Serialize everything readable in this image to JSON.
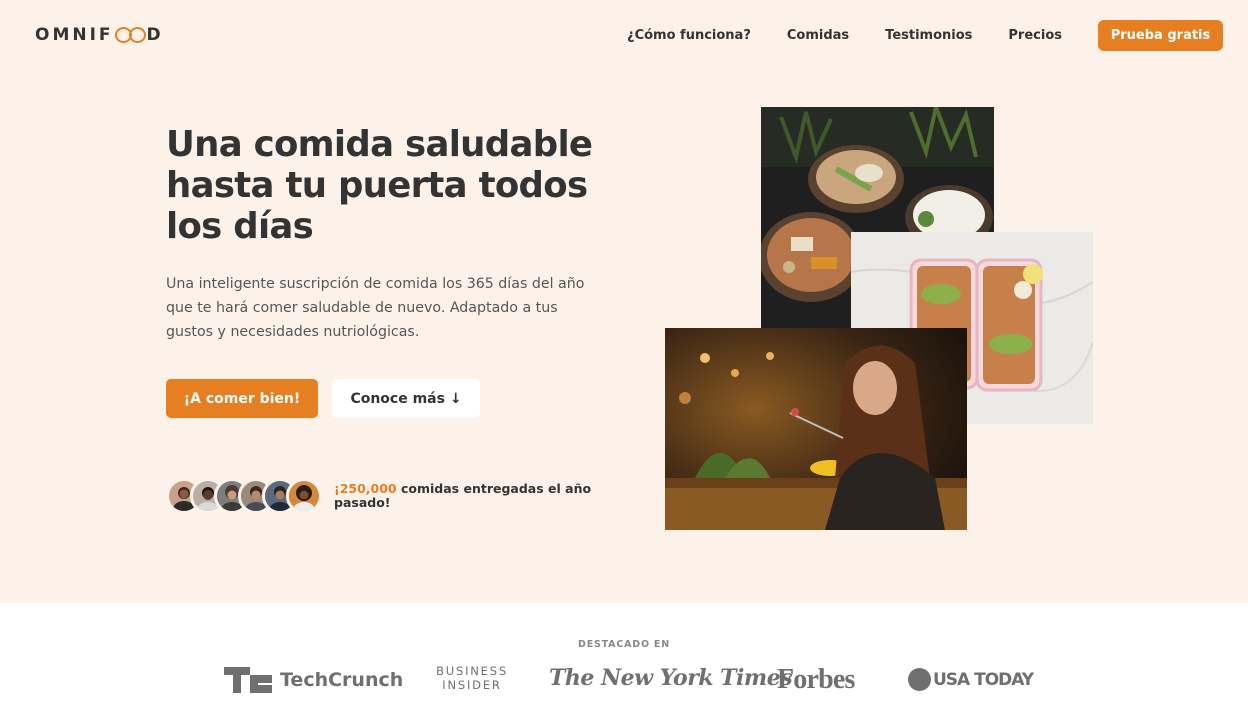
{
  "brand": {
    "logo_prefix": "OMNIF",
    "logo_suffix": "D",
    "accent_color": "#e67e22",
    "background_color": "#fdf2e9"
  },
  "nav": {
    "items": [
      {
        "label": "¿Cómo funciona?"
      },
      {
        "label": "Comidas"
      },
      {
        "label": "Testimonios"
      },
      {
        "label": "Precios"
      }
    ],
    "cta_label": "Prueba gratis"
  },
  "hero": {
    "title": "Una comida saludable hasta tu puerta todos los días",
    "description": "Una inteligente suscripción de comida los 365 días del año que te hará comer saludable de nuevo. Adaptado a tus gustos y necesidades nutriológicas.",
    "primary_button": "¡A comer bien!",
    "secondary_button": "Conoce más ↓",
    "delivered_highlight": "¡250,000",
    "delivered_text": " comidas entregadas el año pasado!",
    "customer_avatar_count": 6
  },
  "featured": {
    "heading": "DESTACADO EN",
    "logos": {
      "techcrunch": "TechCrunch",
      "business_insider_line1": "BUSINESS",
      "business_insider_line2": "INSIDER",
      "nyt": "The New York Times",
      "forbes": "Forbes",
      "usa_today": "USA TODAY"
    }
  }
}
